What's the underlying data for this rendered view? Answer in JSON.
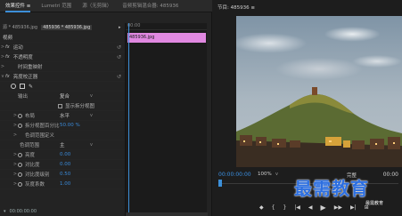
{
  "left_tabs": [
    "效果控件 ≡",
    "Lumetri 范围",
    "源（无剪辑）",
    "音频剪辑混合器: 485936"
  ],
  "source_row": {
    "source": "源 * 485936.jpg",
    "sequence": "485936 * 485936.jpg"
  },
  "mini_timeline": {
    "ruler": "00:00",
    "clip": "485936.jpg",
    "arrow": "▸"
  },
  "properties": {
    "video_header": "视频",
    "motion": "运动",
    "opacity": "不透明度",
    "time_remap": "时间重映射",
    "color_corrector": "亮度校正器",
    "output_label": "输出",
    "output_value": "复合",
    "split_label": "显示拆分视图",
    "layout_label": "布局",
    "layout_value": "水平",
    "split_pct_label": "拆分视图百分比",
    "split_pct_value": "50.00 %",
    "tonal_label": "色调范围定义",
    "tonal_range_label": "色调范围",
    "tonal_range_value": "主",
    "brightness_label": "亮度",
    "brightness_value": "0.00",
    "contrast_label": "对比度",
    "contrast_value": "0.00",
    "contrast_level_label": "对比度级别",
    "contrast_level_value": "0.50",
    "gamma_label": "灰度系数",
    "gamma_value": "1.00",
    "fx": "fx"
  },
  "bottom_timecode": "00:00:00:00",
  "monitor": {
    "title": "节目: 485936 ≡",
    "timecode_left": "00:00:00:00",
    "zoom": "100%",
    "quality": "完整",
    "timecode_right": "00:00"
  },
  "transport": [
    "◆",
    "{",
    "}",
    "|◀",
    "◀",
    "▶",
    "▶▶",
    "▶|",
    "⊞"
  ],
  "watermark": {
    "main": "最需教育",
    "sub": "最需教育"
  },
  "colors": {
    "accent": "#3c8fd8",
    "clip": "#e088e0",
    "value": "#3a8ad9"
  }
}
